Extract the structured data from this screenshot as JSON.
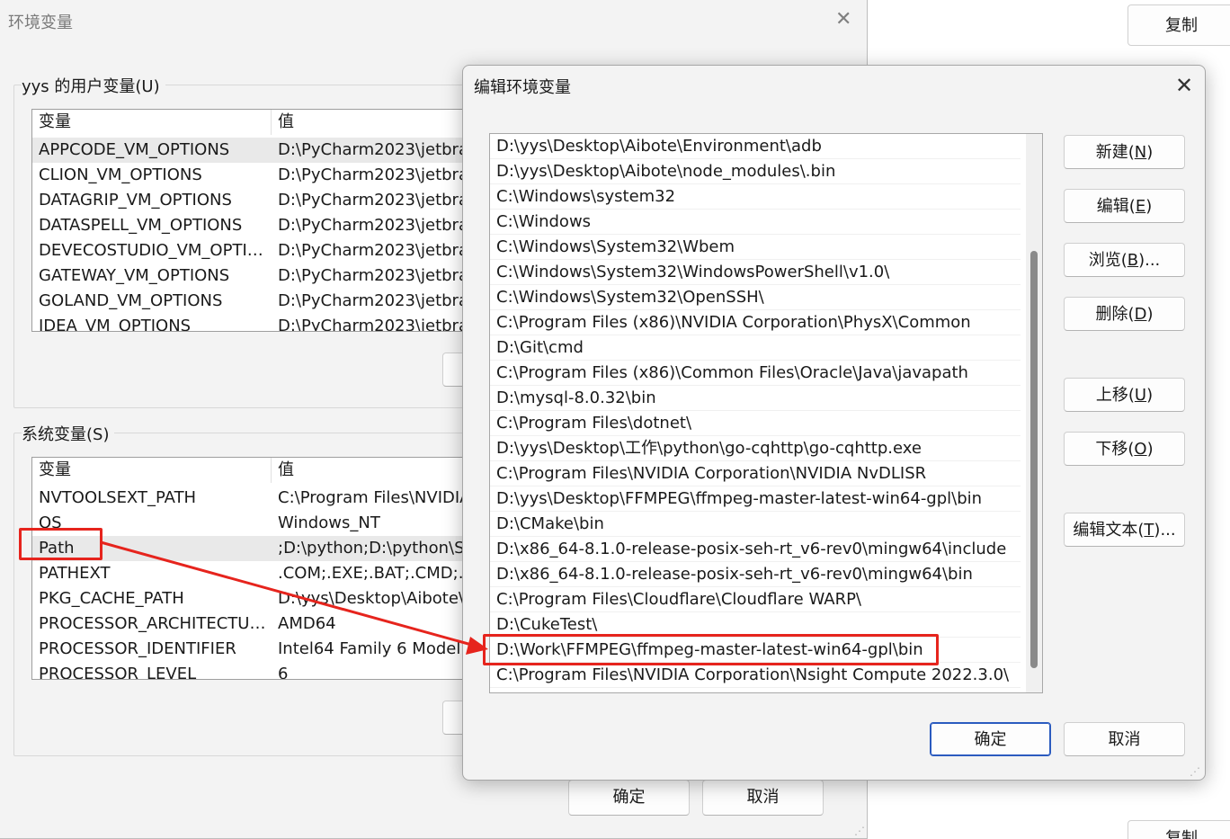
{
  "background": {
    "copy_label": "复制",
    "copy_label_2": "复制"
  },
  "env_window": {
    "title": "环境变量",
    "user_group_label": "yys 的用户变量(U)",
    "system_group_label": "系统变量(S)",
    "col_var": "变量",
    "col_val": "值",
    "user_vars": [
      {
        "name": "APPCODE_VM_OPTIONS",
        "value": "D:\\PyCharm2023\\jetbra"
      },
      {
        "name": "CLION_VM_OPTIONS",
        "value": "D:\\PyCharm2023\\jetbra"
      },
      {
        "name": "DATAGRIP_VM_OPTIONS",
        "value": "D:\\PyCharm2023\\jetbra"
      },
      {
        "name": "DATASPELL_VM_OPTIONS",
        "value": "D:\\PyCharm2023\\jetbra"
      },
      {
        "name": "DEVECOSTUDIO_VM_OPTIO...",
        "value": "D:\\PyCharm2023\\jetbra"
      },
      {
        "name": "GATEWAY_VM_OPTIONS",
        "value": "D:\\PyCharm2023\\jetbra"
      },
      {
        "name": "GOLAND_VM_OPTIONS",
        "value": "D:\\PyCharm2023\\jetbra"
      },
      {
        "name": "IDEA_VM_OPTIONS",
        "value": "D:\\PyCharm2023\\jetbra"
      }
    ],
    "system_vars": [
      {
        "name": "NVTOOLSEXT_PATH",
        "value": "C:\\Program Files\\NVIDIA"
      },
      {
        "name": "OS",
        "value": "Windows_NT"
      },
      {
        "name": "Path",
        "value": ";D:\\python;D:\\python\\Sc"
      },
      {
        "name": "PATHEXT",
        "value": ".COM;.EXE;.BAT;.CMD;.VI"
      },
      {
        "name": "PKG_CACHE_PATH",
        "value": "D:\\yys\\Desktop\\Aibote\\"
      },
      {
        "name": "PROCESSOR_ARCHITECTURE",
        "value": "AMD64"
      },
      {
        "name": "PROCESSOR_IDENTIFIER",
        "value": "Intel64 Family 6 Model"
      },
      {
        "name": "PROCESSOR_LEVEL",
        "value": "6"
      }
    ],
    "ok_label": "确定",
    "cancel_label": "取消"
  },
  "edit_dialog": {
    "title": "编辑环境变量",
    "paths": [
      "D:\\yys\\Desktop\\Aibote\\Environment\\adb",
      "D:\\yys\\Desktop\\Aibote\\node_modules\\.bin",
      "C:\\Windows\\system32",
      "C:\\Windows",
      "C:\\Windows\\System32\\Wbem",
      "C:\\Windows\\System32\\WindowsPowerShell\\v1.0\\",
      "C:\\Windows\\System32\\OpenSSH\\",
      "C:\\Program Files (x86)\\NVIDIA Corporation\\PhysX\\Common",
      "D:\\Git\\cmd",
      "C:\\Program Files (x86)\\Common Files\\Oracle\\Java\\javapath",
      "D:\\mysql-8.0.32\\bin",
      "C:\\Program Files\\dotnet\\",
      "D:\\yys\\Desktop\\工作\\python\\go-cqhttp\\go-cqhttp.exe",
      "C:\\Program Files\\NVIDIA Corporation\\NVIDIA NvDLISR",
      "D:\\yys\\Desktop\\FFMPEG\\ffmpeg-master-latest-win64-gpl\\bin",
      "D:\\CMake\\bin",
      "D:\\x86_64-8.1.0-release-posix-seh-rt_v6-rev0\\mingw64\\include",
      "D:\\x86_64-8.1.0-release-posix-seh-rt_v6-rev0\\mingw64\\bin",
      "C:\\Program Files\\Cloudflare\\Cloudflare WARP\\",
      "D:\\CukeTest\\",
      "D:\\Work\\FFMPEG\\ffmpeg-master-latest-win64-gpl\\bin",
      "C:\\Program Files\\NVIDIA Corporation\\Nsight Compute 2022.3.0\\"
    ],
    "buttons": {
      "new": {
        "text": "新建(",
        "key": "N",
        "end": ")"
      },
      "edit": {
        "text": "编辑(",
        "key": "E",
        "end": ")"
      },
      "browse": {
        "text": "浏览(",
        "key": "B",
        "end": ")..."
      },
      "delete": {
        "text": "删除(",
        "key": "D",
        "end": ")"
      },
      "up": {
        "text": "上移(",
        "key": "U",
        "end": ")"
      },
      "down": {
        "text": "下移(",
        "key": "O",
        "end": ")"
      },
      "edit_text": {
        "text": "编辑文本(",
        "key": "T",
        "end": ")..."
      }
    },
    "ok_label": "确定",
    "cancel_label": "取消"
  },
  "colors": {
    "annotation_red": "#e6241d",
    "ok_border": "#2b5bbf"
  }
}
